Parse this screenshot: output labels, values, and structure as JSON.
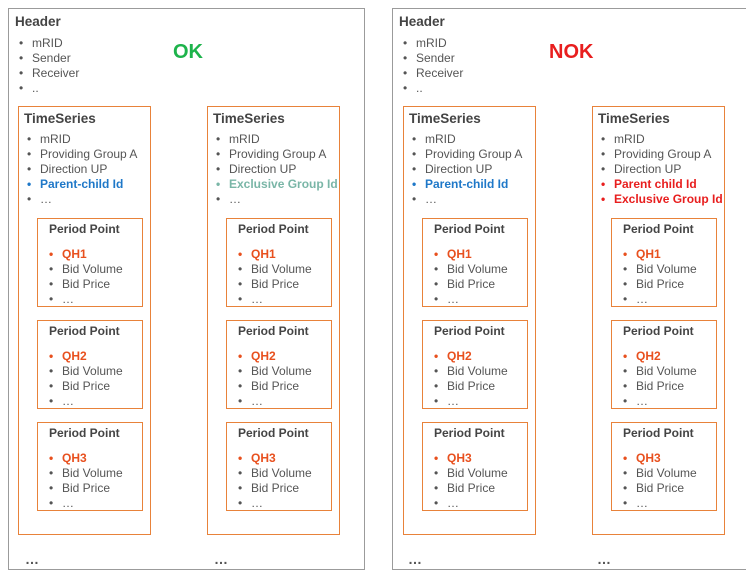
{
  "panels": [
    {
      "header_title": "Header",
      "header_items": [
        "mRID",
        "Sender",
        "Receiver",
        ".."
      ],
      "status": "OK",
      "status_color": "#1db34b",
      "timeseries": [
        {
          "title": "TimeSeries",
          "items": [
            {
              "text": "mRID",
              "style": "gray"
            },
            {
              "text": "Providing Group A",
              "style": "gray"
            },
            {
              "text": "Direction UP",
              "style": "gray"
            },
            {
              "text": "Parent-child Id",
              "style": "blue"
            },
            {
              "text": "…",
              "style": "gray"
            }
          ]
        },
        {
          "title": "TimeSeries",
          "items": [
            {
              "text": "mRID",
              "style": "gray"
            },
            {
              "text": "Providing Group A",
              "style": "gray"
            },
            {
              "text": "Direction UP",
              "style": "gray"
            },
            {
              "text": "Exclusive Group Id",
              "style": "green"
            },
            {
              "text": "…",
              "style": "gray"
            }
          ]
        }
      ],
      "trailing_dots": [
        "…",
        "…"
      ]
    },
    {
      "header_title": "Header",
      "header_items": [
        "mRID",
        "Sender",
        "Receiver",
        ".."
      ],
      "status": "NOK",
      "status_color": "#e81e1e",
      "timeseries": [
        {
          "title": "TimeSeries",
          "items": [
            {
              "text": "mRID",
              "style": "gray"
            },
            {
              "text": "Providing Group A",
              "style": "gray"
            },
            {
              "text": "Direction UP",
              "style": "gray"
            },
            {
              "text": "Parent-child Id",
              "style": "blue"
            },
            {
              "text": "…",
              "style": "gray"
            }
          ]
        },
        {
          "title": "TimeSeries",
          "items": [
            {
              "text": "mRID",
              "style": "gray"
            },
            {
              "text": "Providing Group A",
              "style": "gray"
            },
            {
              "text": "Direction UP",
              "style": "gray"
            },
            {
              "text": "Parent child Id",
              "style": "red"
            },
            {
              "text": "Exclusive Group Id",
              "style": "red"
            }
          ]
        }
      ],
      "trailing_dots": [
        "…",
        "…"
      ]
    }
  ],
  "period_points": [
    {
      "title": "Period Point",
      "items": [
        {
          "text": "QH1",
          "style": "orange"
        },
        {
          "text": "Bid Volume",
          "style": "gray"
        },
        {
          "text": "Bid Price",
          "style": "gray"
        },
        {
          "text": "…",
          "style": "gray"
        }
      ]
    },
    {
      "title": "Period Point",
      "items": [
        {
          "text": "QH2",
          "style": "orange"
        },
        {
          "text": "Bid Volume",
          "style": "gray"
        },
        {
          "text": "Bid Price",
          "style": "gray"
        },
        {
          "text": "…",
          "style": "gray"
        }
      ]
    },
    {
      "title": "Period Point",
      "items": [
        {
          "text": "QH3",
          "style": "orange"
        },
        {
          "text": "Bid Volume",
          "style": "gray"
        },
        {
          "text": "Bid Price",
          "style": "gray"
        },
        {
          "text": "…",
          "style": "gray"
        }
      ]
    }
  ]
}
